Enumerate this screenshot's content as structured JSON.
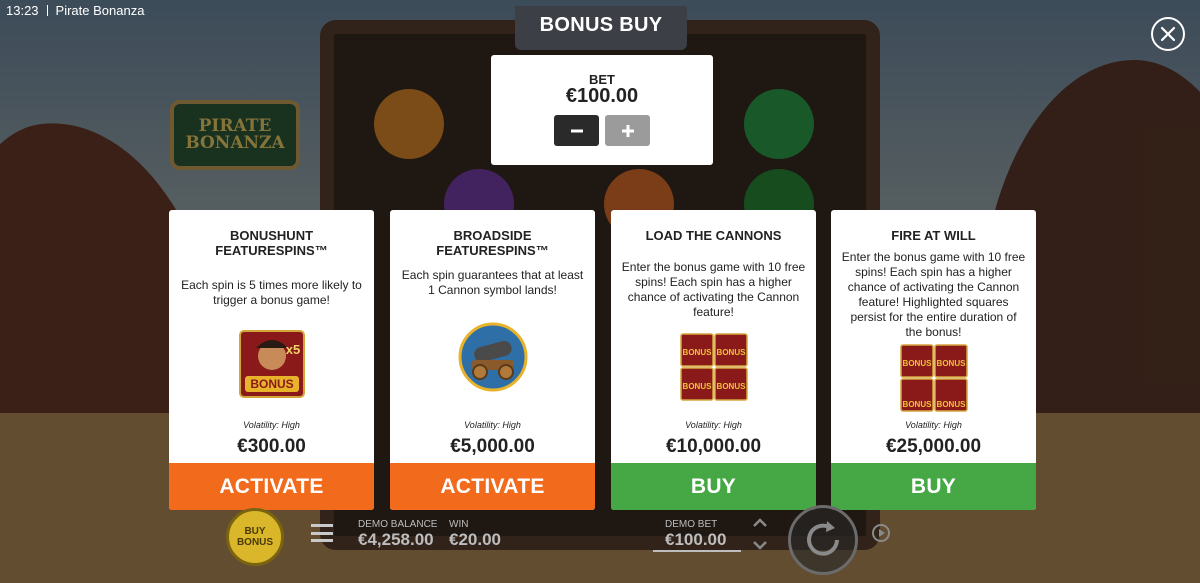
{
  "status_bar": {
    "time": "13:23",
    "app_name": "Pirate Bonanza"
  },
  "game_logo": {
    "text": "PIRATE BONANZA"
  },
  "dialog": {
    "title": "BONUS BUY",
    "close_icon": "close-icon"
  },
  "bet": {
    "label": "BET",
    "value": "€100.00",
    "decrease_icon": "minus-icon",
    "increase_icon": "plus-icon"
  },
  "cards": [
    {
      "title": "BONUSHUNT FEATURESPINS™",
      "description": "Each spin is 5 times more likely to trigger a bonus game!",
      "art_icon": "bonus-x5-symbol-icon",
      "badge": "x5",
      "art_text": "BONUS",
      "volatility": "Volatility: High",
      "price": "€300.00",
      "button": "ACTIVATE",
      "button_color": "#f26a1b"
    },
    {
      "title": "BROADSIDE FEATURESPINS™",
      "description": "Each spin guarantees that at least 1 Cannon symbol lands!",
      "art_icon": "cannon-symbol-icon",
      "volatility": "Volatility: High",
      "price": "€5,000.00",
      "button": "ACTIVATE",
      "button_color": "#f26a1b"
    },
    {
      "title": "LOAD THE CANNONS",
      "description": "Enter the bonus game with 10 free spins! Each spin has a higher chance of activating the Cannon feature!",
      "art_icon": "bonus-symbol-grid-icon",
      "art_text": "BONUS",
      "volatility": "Volatility: High",
      "price": "€10,000.00",
      "button": "BUY",
      "button_color": "#45a845"
    },
    {
      "title": "FIRE AT WILL",
      "description": "Enter the bonus game with 10 free spins! Each spin has a higher chance of activating the Cannon feature! Highlighted squares persist for the entire duration of the bonus!",
      "art_icon": "bonus-symbol-grid-icon",
      "art_text": "BONUS",
      "volatility": "Volatility: High",
      "price": "€25,000.00",
      "button": "BUY",
      "button_color": "#45a845"
    }
  ],
  "bottom_bar": {
    "buy_bonus_label": "BUY BONUS",
    "demo_balance_label": "DEMO BALANCE",
    "demo_balance_value": "€4,258.00",
    "win_label": "WIN",
    "win_value": "€20.00",
    "demo_bet_label": "DEMO BET",
    "demo_bet_value": "€100.00"
  }
}
